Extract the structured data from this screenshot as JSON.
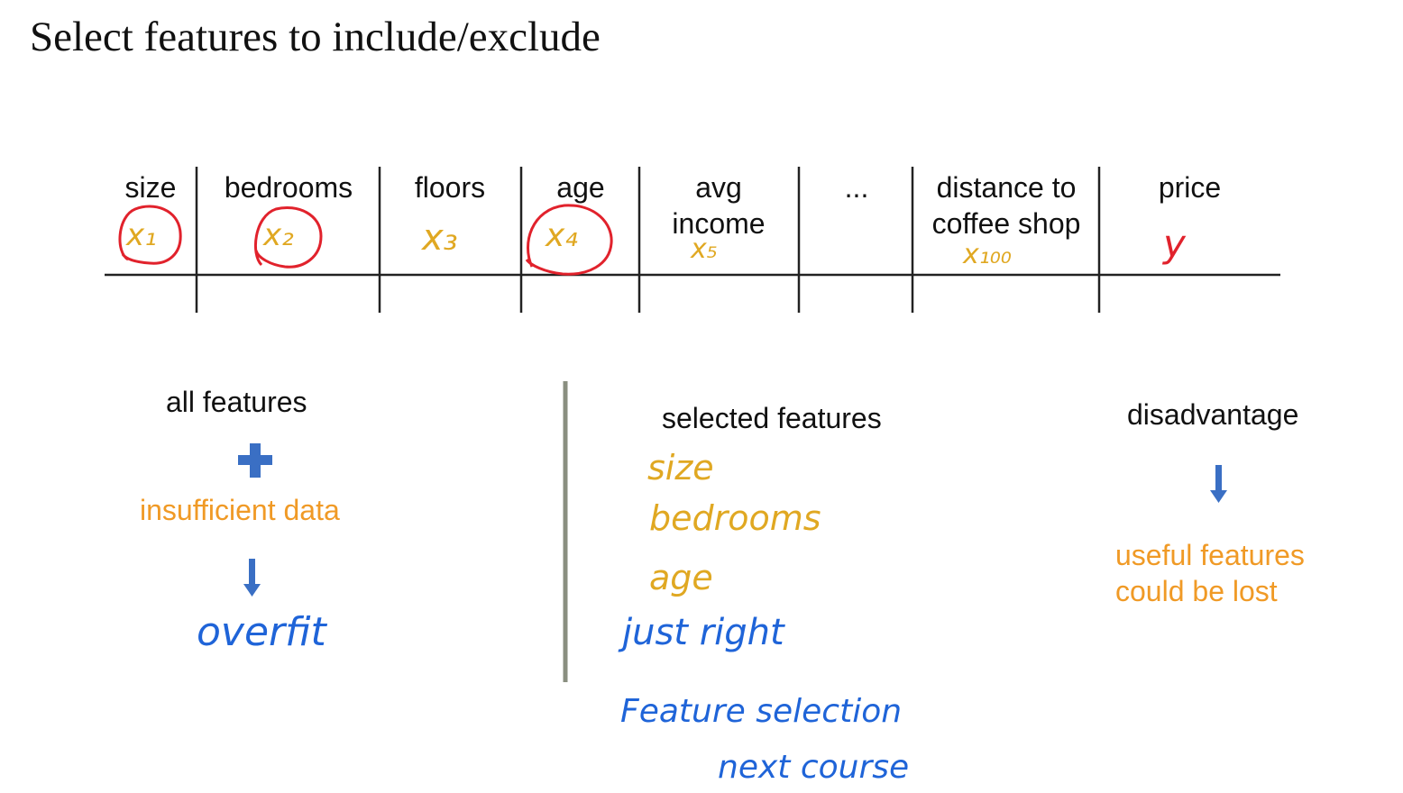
{
  "title": "Select features to include/exclude",
  "table": {
    "columns": [
      {
        "header": "size",
        "symbol": "x₁",
        "circled": true
      },
      {
        "header": "bedrooms",
        "symbol": "x₂",
        "circled": true
      },
      {
        "header": "floors",
        "symbol": "x₃",
        "circled": false
      },
      {
        "header": "age",
        "symbol": "x₄",
        "circled": true
      },
      {
        "header": "avg income",
        "symbol": "x₅",
        "circled": false
      },
      {
        "header": "...",
        "symbol": "",
        "circled": false
      },
      {
        "header": "distance to coffee shop",
        "symbol": "x₁₀₀",
        "circled": false
      },
      {
        "header": "price",
        "symbol": "y",
        "circled": false
      }
    ]
  },
  "left": {
    "heading": "all features",
    "plus_icon": "plus-icon",
    "condition": "insufficient data",
    "arrow_icon": "arrow-down-icon",
    "result": "overfit"
  },
  "middle": {
    "heading": "selected features",
    "features": [
      "size",
      "bedrooms",
      "age"
    ],
    "result": "just right",
    "note_line1": "Feature selection",
    "note_line2": "next course"
  },
  "right": {
    "heading": "disadvantage",
    "arrow_icon": "arrow-down-icon",
    "consequence_line1": "useful features",
    "consequence_line2": "could be lost"
  },
  "colors": {
    "handwriting_yellow": "#e0a822",
    "handwriting_blue": "#1f64d8",
    "handwriting_red": "#e1222c",
    "text_orange": "#f09a26",
    "icon_blue": "#3a6fc4",
    "divider": "#8a8f80"
  }
}
